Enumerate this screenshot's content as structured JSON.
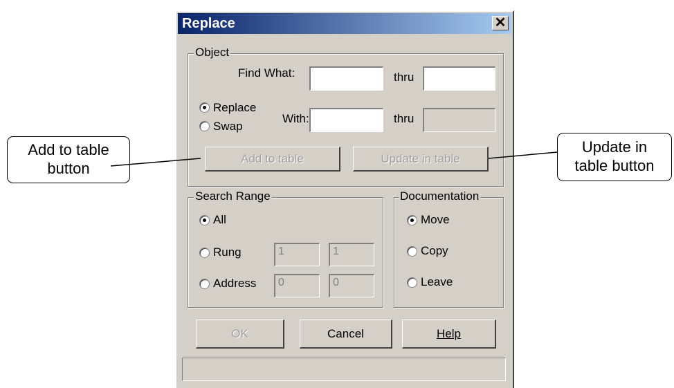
{
  "dialog": {
    "title": "Replace",
    "close_label": "✕"
  },
  "object_group": {
    "legend": "Object",
    "find_what_label": "Find What:",
    "thru_label_1": "thru",
    "replace_label": "Replace",
    "swap_label": "Swap",
    "with_label": "With:",
    "thru_label_2": "thru",
    "add_to_table_label": "Add to table",
    "update_in_table_label": "Update in table"
  },
  "search_range": {
    "legend": "Search Range",
    "all_label": "All",
    "rung_label": "Rung",
    "rung_from": "1",
    "rung_to": "1",
    "address_label": "Address",
    "address_from": "0",
    "address_to": "0"
  },
  "documentation": {
    "legend": "Documentation",
    "move_label": "Move",
    "copy_label": "Copy",
    "leave_label": "Leave"
  },
  "buttons": {
    "ok_label": "OK",
    "cancel_label": "Cancel",
    "help_label": "Help"
  },
  "callouts": {
    "add_line1": "Add to table",
    "add_line2": "button",
    "update_line1": "Update in",
    "update_line2": "table button"
  }
}
